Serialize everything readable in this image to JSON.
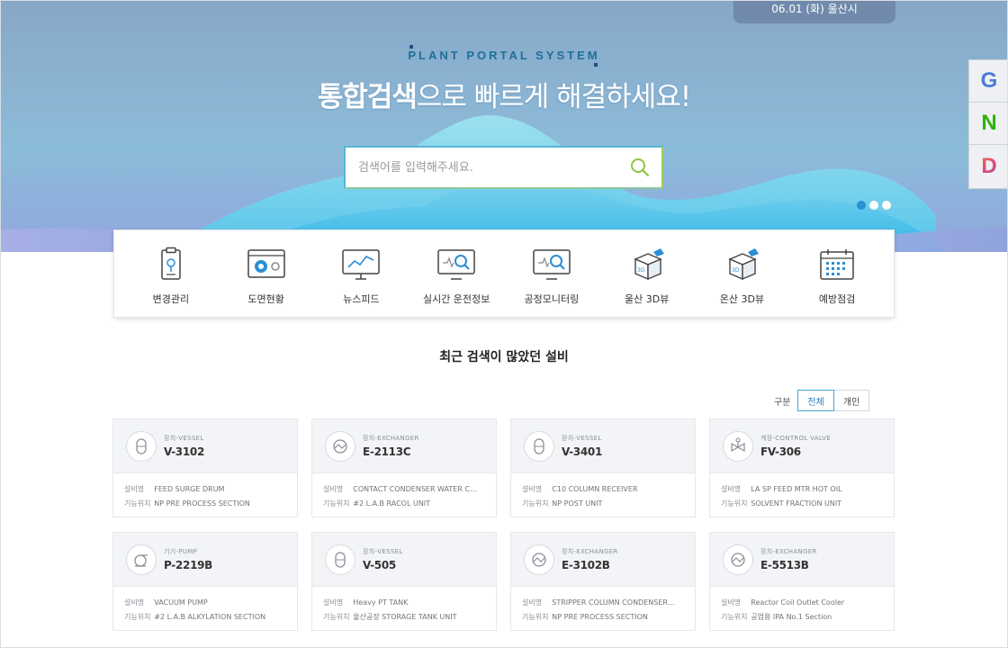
{
  "header": {
    "date_location": "06.01 (화)  울산시",
    "system_label": "PLANT PORTAL SYSTEM",
    "headline_strong": "통합검색",
    "headline_rest": "으로 빠르게 해결하세요!"
  },
  "search": {
    "placeholder": "검색어를 입력해주세요.",
    "value": ""
  },
  "quick_links": [
    {
      "letter": "G",
      "icon": "google-icon"
    },
    {
      "letter": "N",
      "icon": "naver-icon"
    },
    {
      "letter": "D",
      "icon": "daum-icon"
    }
  ],
  "slider": {
    "count": 3,
    "active": 0
  },
  "menu": [
    {
      "label": "변경관리",
      "icon": "clipboard-icon"
    },
    {
      "label": "도면현황",
      "icon": "drawing-icon"
    },
    {
      "label": "뉴스피드",
      "icon": "chart-monitor-icon"
    },
    {
      "label": "실시간 운전정보",
      "icon": "monitor-search-icon"
    },
    {
      "label": "공정모니터링",
      "icon": "monitor-search-icon"
    },
    {
      "label": "울산 3D뷰",
      "icon": "3d-cube-icon"
    },
    {
      "label": "온산 3D뷰",
      "icon": "3d-cube-icon"
    },
    {
      "label": "예방점검",
      "icon": "calendar-icon"
    }
  ],
  "section": {
    "title": "최근 검색이 많았던 설비",
    "filter_label": "구분",
    "filter_all": "전체",
    "filter_personal": "개인"
  },
  "equipment": [
    {
      "type": "장치-VESSEL",
      "tag": "V-3102",
      "name_label": "설비명",
      "name": "FEED SURGE DRUM",
      "loc_label": "기능위치",
      "location": "NP PRE PROCESS SECTION",
      "icon": "vessel-icon"
    },
    {
      "type": "장치-EXCHANGER",
      "tag": "E-2113C",
      "name_label": "설비명",
      "name": "CONTACT CONDENSER WATER C…",
      "loc_label": "기능위치",
      "location": "#2 L.A.B RACOL UNIT",
      "icon": "exchanger-icon"
    },
    {
      "type": "장치-VESSEL",
      "tag": "V-3401",
      "name_label": "설비명",
      "name": "C10 COLUMN RECEIVER",
      "loc_label": "기능위치",
      "location": "NP POST UNIT",
      "icon": "vessel-icon"
    },
    {
      "type": "계장-CONTROL VALVE",
      "tag": "FV-306",
      "name_label": "설비명",
      "name": "LA SP FEED MTR HOT OIL",
      "loc_label": "기능위치",
      "location": "SOLVENT FRACTION UNIT",
      "icon": "valve-icon"
    },
    {
      "type": "기기-PUMP",
      "tag": "P-2219B",
      "name_label": "설비명",
      "name": "VACUUM PUMP",
      "loc_label": "기능위치",
      "location": "#2 L.A.B ALKYLATION SECTION",
      "icon": "pump-icon"
    },
    {
      "type": "장치-VESSEL",
      "tag": "V-505",
      "name_label": "설비명",
      "name": "Heavy PT TANK",
      "loc_label": "기능위치",
      "location": "울산공장 STORAGE TANK UNIT",
      "icon": "vessel-icon"
    },
    {
      "type": "장치-EXCHANGER",
      "tag": "E-3102B",
      "name_label": "설비명",
      "name": "STRIPPER COLUMN CONDENSER…",
      "loc_label": "기능위치",
      "location": "NP PRE PROCESS SECTION",
      "icon": "exchanger-icon"
    },
    {
      "type": "장치-EXCHANGER",
      "tag": "E-5513B",
      "name_label": "설비명",
      "name": "Reactor Coil Outlet Cooler",
      "loc_label": "기능위치",
      "location": "공업용 IPA No.1 Section",
      "icon": "exchanger-icon"
    }
  ],
  "colors": {
    "accent": "#2a8fd6",
    "hero_top": "#87a7c8",
    "hero_bottom": "#92a6dd"
  }
}
